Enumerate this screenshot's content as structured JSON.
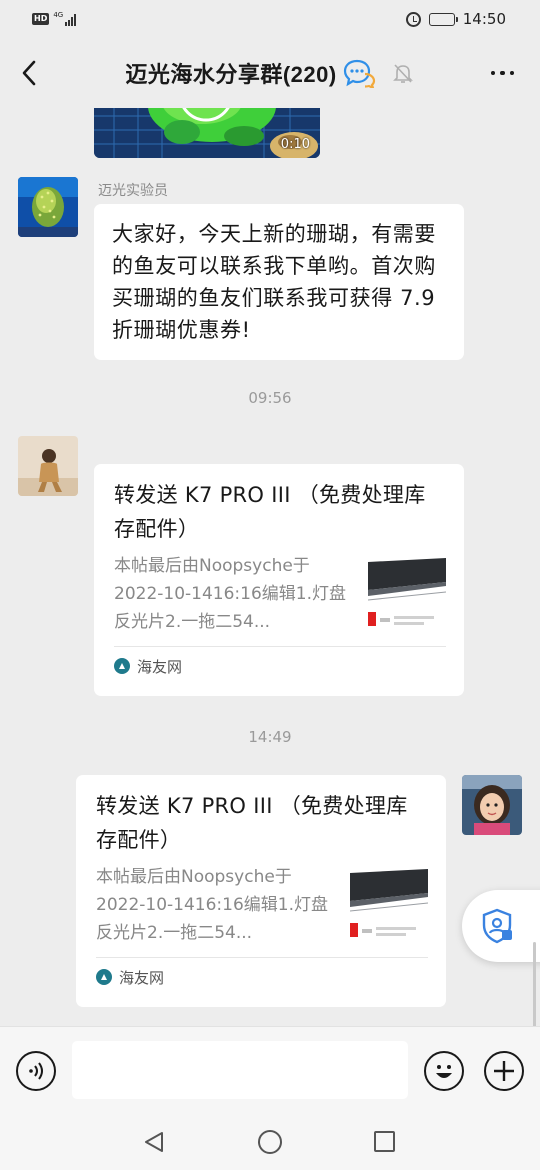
{
  "status_bar": {
    "hd_badge": "HD",
    "network": "4G",
    "time": "14:50",
    "battery_level": 0.55
  },
  "header": {
    "title": "迈光海水分享群(220)",
    "icons": [
      "back-arrow-icon",
      "chat-bubbles-icon",
      "mute-bell-icon",
      "more-icon"
    ]
  },
  "chat": {
    "video": {
      "duration": "0:10"
    },
    "messages": [
      {
        "sender": "迈光实验员",
        "text": "大家好，今天上新的珊瑚，有需要的鱼友可以联系我下单哟。首次购买珊瑚的鱼友们联系我可获得 7.9 折珊瑚优惠券!"
      }
    ],
    "timestamps": [
      "09:56",
      "14:49"
    ],
    "cards": [
      {
        "title": "转发送 K7 PRO III （免费处理库存配件）",
        "description": "本帖最后由Noopsyche于2022-10-1416:16编辑1.灯盘反光片2.一拖二54...",
        "source": "海友网"
      },
      {
        "title": "转发送 K7 PRO III （免费处理库存配件）",
        "description": "本帖最后由Noopsyche于2022-10-1416:16编辑1.灯盘反光片2.一拖二54...",
        "source": "海友网"
      }
    ]
  },
  "input_bar": {
    "placeholder": "",
    "icons": [
      "voice-icon",
      "emoji-icon",
      "plus-icon"
    ]
  },
  "colors": {
    "background": "#ededed",
    "bubble": "#ffffff",
    "accent_blue": "#2f8fe8"
  }
}
